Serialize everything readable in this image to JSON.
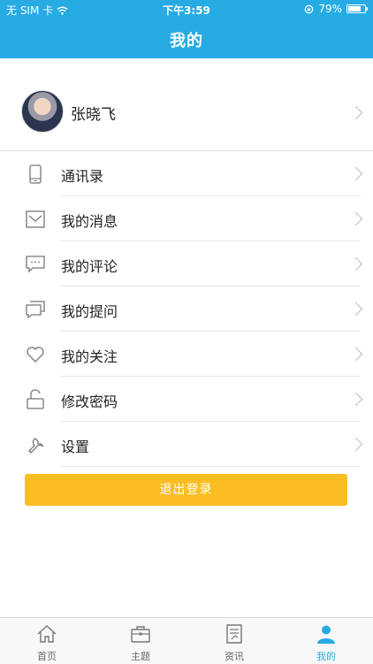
{
  "status_bar": {
    "carrier": "无 SIM 卡",
    "time": "下午3:59",
    "battery_percent": "79%",
    "battery_level": 0.79
  },
  "nav": {
    "title": "我的"
  },
  "profile": {
    "name": "张晓飞"
  },
  "menu": [
    {
      "label": "通讯录",
      "icon": "phone-icon"
    },
    {
      "label": "我的消息",
      "icon": "envelope-icon"
    },
    {
      "label": "我的评论",
      "icon": "comment-icon"
    },
    {
      "label": "我的提问",
      "icon": "question-chat-icon"
    },
    {
      "label": "我的关注",
      "icon": "heart-icon"
    },
    {
      "label": "修改密码",
      "icon": "lock-icon"
    },
    {
      "label": "设置",
      "icon": "wrench-icon"
    }
  ],
  "logout_label": "退出登录",
  "tabs": [
    {
      "label": "首页",
      "icon": "home-icon",
      "active": false
    },
    {
      "label": "主题",
      "icon": "briefcase-icon",
      "active": false
    },
    {
      "label": "资讯",
      "icon": "document-icon",
      "active": false
    },
    {
      "label": "我的",
      "icon": "person-icon",
      "active": true
    }
  ],
  "colors": {
    "header": "#27abe3",
    "accent": "#27abe3",
    "logout_button": "#fbbd22"
  }
}
